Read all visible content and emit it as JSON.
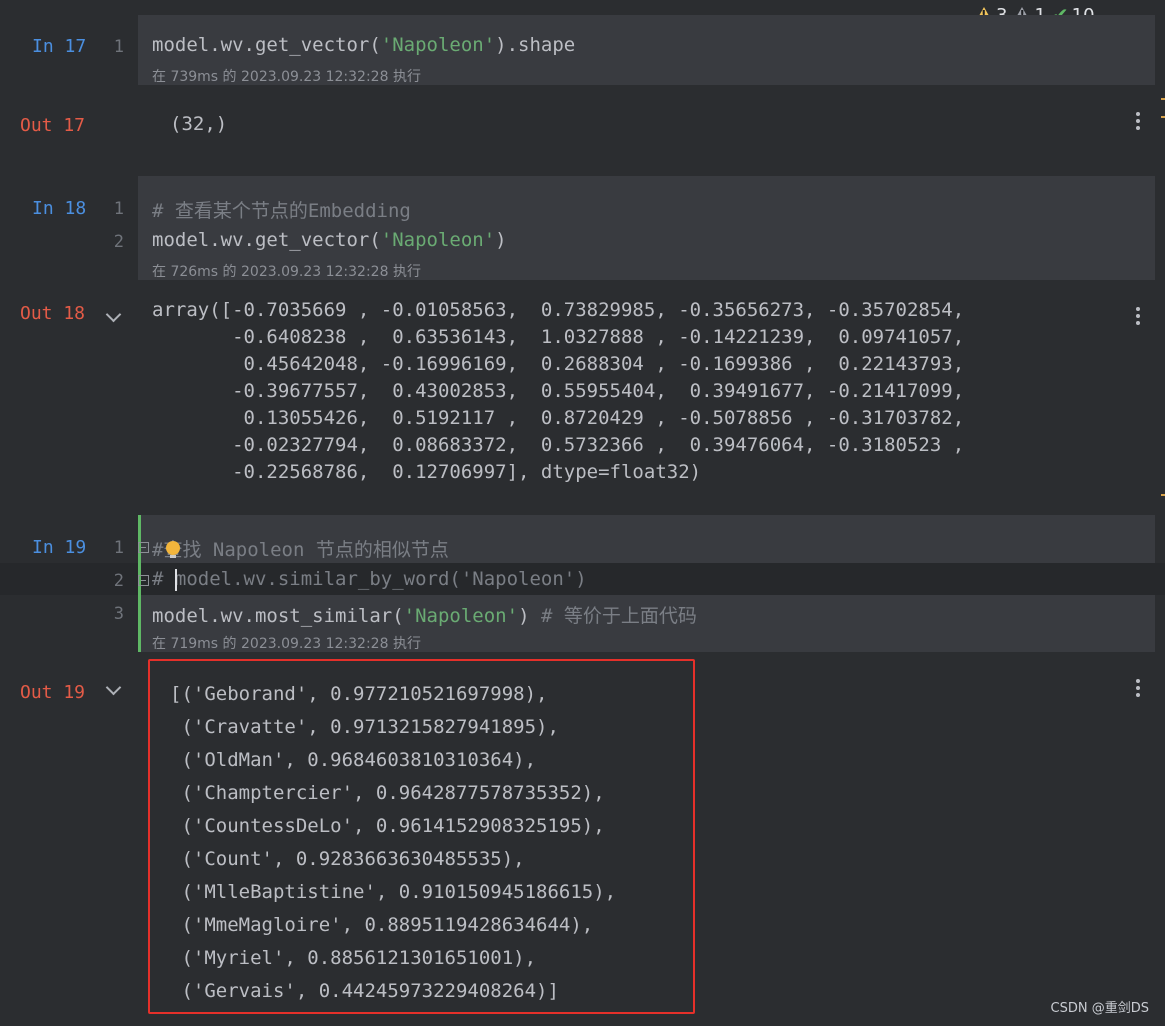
{
  "inspections": {
    "warnings": "3",
    "weak_warnings": "1",
    "typos": "10"
  },
  "cells": [
    {
      "in_prompt": "In 17",
      "lines": [
        {
          "num": "1",
          "pre": "model.wv.get_vector(",
          "str": "'Napoleon'",
          "post": ").shape"
        }
      ],
      "exec_info": "在 739ms 的 2023.09.23 12:32:28 执行",
      "out_prompt": "Out 17",
      "output": "(32,)"
    },
    {
      "in_prompt": "In 18",
      "lines": [
        {
          "num": "1",
          "comment_hash": "# ",
          "comment_cjk": "查看某个节点的",
          "comment_tail": "Embedding"
        },
        {
          "num": "2",
          "pre": "model.wv.get_vector(",
          "str": "'Napoleon'",
          "post": ")"
        }
      ],
      "exec_info": "在 726ms 的 2023.09.23 12:32:28 执行",
      "out_prompt": "Out 18",
      "output": "array([-0.7035669 , -0.01058563,  0.73829985, -0.35656273, -0.35702854,\n       -0.6408238 ,  0.63536143,  1.0327888 , -0.14221239,  0.09741057,\n        0.45642048, -0.16996169,  0.2688304 , -0.1699386 ,  0.22143793,\n       -0.39677557,  0.43002853,  0.55955404,  0.39491677, -0.21417099,\n        0.13055426,  0.5192117 ,  0.8720429 , -0.5078856 , -0.31703782,\n       -0.02327794,  0.08683372,  0.5732366 ,  0.39476064, -0.3180523 ,\n       -0.22568786,  0.12706997], dtype=float32)"
    },
    {
      "in_prompt": "In 19",
      "lines": [
        {
          "num": "1",
          "l1_hash": "#",
          "l1_cjk_a": "查找",
          "l1_mid": " Napoleon ",
          "l1_cjk_b": "节点的相似节点"
        },
        {
          "num": "2",
          "l2": "# model.wv.similar_by_word('Napoleon')"
        },
        {
          "num": "3",
          "pre": "model.wv.most_similar(",
          "str": "'Napoleon'",
          "post": ") ",
          "cmt_hash": "# ",
          "cmt_cjk": "等价于上面代码"
        }
      ],
      "exec_info": "在 719ms 的 2023.09.23 12:32:28 执行",
      "out_prompt": "Out 19",
      "output": "[('Geborand', 0.977210521697998),\n ('Cravatte', 0.9713215827941895),\n ('OldMan', 0.9684603810310364),\n ('Champtercier', 0.9642877578735352),\n ('CountessDeLo', 0.9614152908325195),\n ('Count', 0.9283663630485535),\n ('MlleBaptistine', 0.910150945186615),\n ('MmeMagloire', 0.8895119428634644),\n ('Myriel', 0.8856121301651001),\n ('Gervais', 0.44245973229408264)]"
    }
  ],
  "watermark": "CSDN @重剑DS"
}
